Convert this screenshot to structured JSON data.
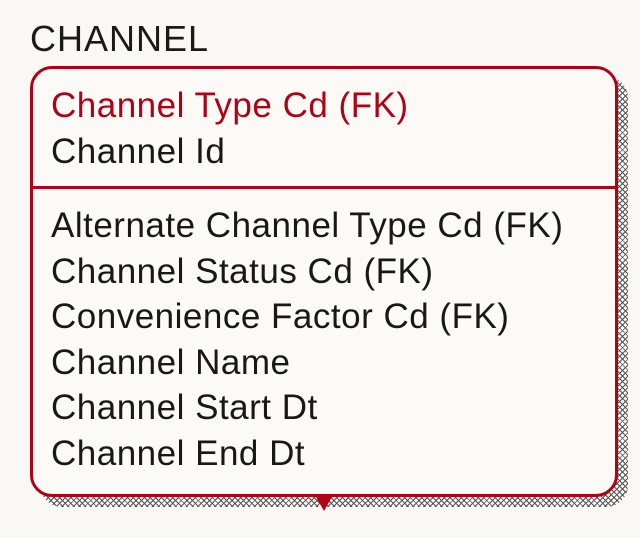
{
  "entity": {
    "name": "CHANNEL",
    "primary": [
      {
        "label": "Channel Type Cd (FK)",
        "highlight": true
      },
      {
        "label": "Channel Id",
        "highlight": false
      }
    ],
    "attributes": [
      {
        "label": "Alternate Channel Type Cd (FK)"
      },
      {
        "label": "Channel Status Cd (FK)"
      },
      {
        "label": "Convenience Factor Cd (FK)"
      },
      {
        "label": "Channel Name"
      },
      {
        "label": "Channel Start Dt"
      },
      {
        "label": "Channel End Dt"
      }
    ]
  },
  "colors": {
    "accent": "#b20015",
    "text": "#181818",
    "bg": "#fbfaf7"
  }
}
